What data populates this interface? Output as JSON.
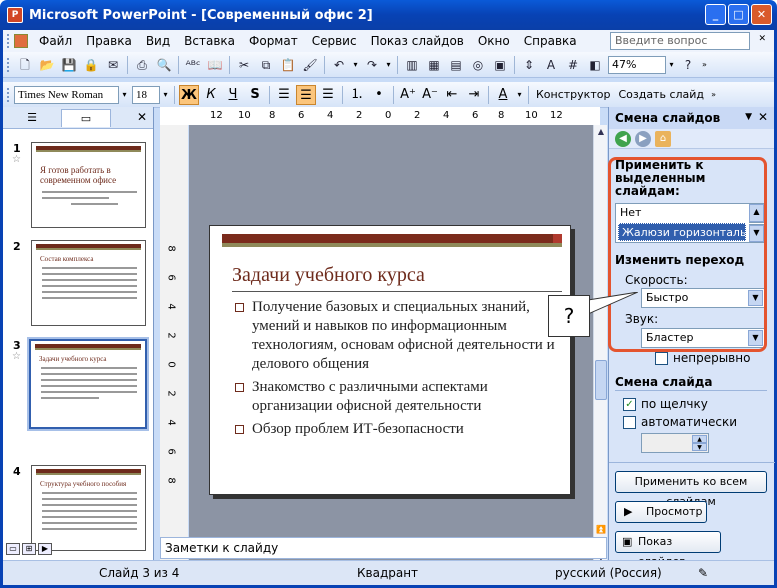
{
  "window": {
    "title": "Microsoft PowerPoint - [Современный офис 2]"
  },
  "menu": {
    "items": [
      "Файл",
      "Правка",
      "Вид",
      "Вставка",
      "Формат",
      "Сервис",
      "Показ слайдов",
      "Окно",
      "Справка"
    ],
    "ask_placeholder": "Введите вопрос"
  },
  "toolbar": {
    "zoom": "47%"
  },
  "format_toolbar": {
    "font": "Times New Roman",
    "size": "18",
    "bold": "Ж",
    "italic": "К",
    "underline": "Ч",
    "shadow": "S",
    "designer": "Конструктор",
    "new_slide": "Создать слайд"
  },
  "rulers": {
    "h": [
      "12",
      "10",
      "8",
      "6",
      "4",
      "2",
      "0",
      "2",
      "4",
      "6",
      "8",
      "10",
      "12"
    ],
    "v": [
      "8",
      "6",
      "4",
      "2",
      "0",
      "2",
      "4",
      "6",
      "8"
    ]
  },
  "thumbnails": [
    {
      "num": "1",
      "title": "Я готов работать в современном офисе"
    },
    {
      "num": "2",
      "title": "Состав комплекса"
    },
    {
      "num": "3",
      "title": "Задачи учебного курса"
    },
    {
      "num": "4",
      "title": "Структура учебного пособия"
    }
  ],
  "slide": {
    "title": "Задачи учебного курса",
    "bullets": [
      "Получение базовых и специальных знаний, умений и навыков по информационным технологиям, основам офисной деятельности и делового общения",
      "Знакомство с различными аспектами организации офисной деятельности",
      "Обзор проблем ИТ-безопасности"
    ]
  },
  "callout": "?",
  "notes_placeholder": "Заметки к слайду",
  "status": {
    "slide": "Слайд 3 из 4",
    "design": "Квадрант",
    "language": "русский (Россия)"
  },
  "taskpane": {
    "title": "Смена слайдов",
    "apply_label": "Применить к выделенным слайдам:",
    "list": [
      "Нет",
      "Жалюзи горизонтальн..."
    ],
    "modify_label": "Изменить переход",
    "speed_label": "Скорость:",
    "speed_value": "Быстро",
    "sound_label": "Звук:",
    "sound_value": "Бластер",
    "loop": "непрерывно",
    "advance_label": "Смена слайда",
    "on_click": "по щелчку",
    "auto_after": "автоматически после",
    "apply_all": "Применить ко всем слайдам",
    "preview": "Просмотр",
    "slideshow": "Показ слайдов"
  }
}
